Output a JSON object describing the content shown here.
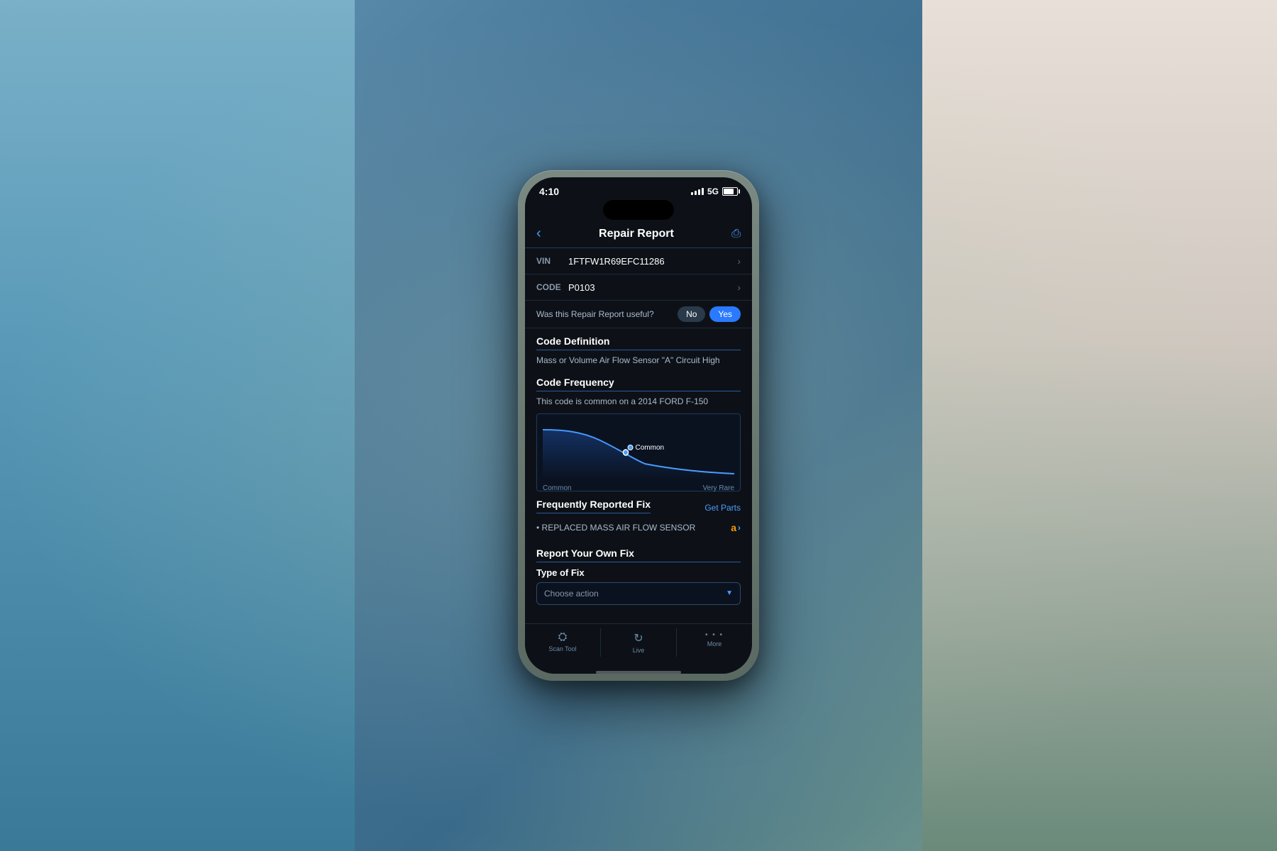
{
  "scene": {
    "background": "blurred car interior with blue frame visible"
  },
  "status_bar": {
    "time": "4:10",
    "signal_label": "5G",
    "battery_level": "80%"
  },
  "nav_header": {
    "back_icon": "chevron-left",
    "title": "Repair Report",
    "share_icon": "share"
  },
  "vin_field": {
    "label": "VIN",
    "value": "1FTFW1R69EFC11286",
    "chevron": "›"
  },
  "code_field": {
    "label": "CODE",
    "value": "P0103",
    "chevron": "›"
  },
  "useful_bar": {
    "question": "Was this Repair Report useful?",
    "no_label": "No",
    "yes_label": "Yes"
  },
  "code_definition": {
    "title": "Code Definition",
    "text": "Mass or Volume Air Flow Sensor \"A\" Circuit High"
  },
  "code_frequency": {
    "title": "Code Frequency",
    "description": "This code is common on a 2014 FORD F-150",
    "chart": {
      "point_label": "Common",
      "x_axis_left": "Common",
      "x_axis_right": "Very Rare"
    }
  },
  "frequently_reported_fix": {
    "title": "Frequently Reported Fix",
    "get_parts_label": "Get Parts",
    "fix_item": "• REPLACED MASS AIR FLOW SENSOR",
    "amazon_label": "a",
    "arrow_label": "›"
  },
  "report_own_fix": {
    "title": "Report Your Own Fix",
    "type_of_fix_label": "Type of Fix",
    "dropdown_placeholder": "Choose action",
    "dropdown_arrow": "▼"
  },
  "bottom_nav": {
    "items": [
      {
        "id": "scan-tool",
        "icon": "🔧",
        "label": "Scan Tool"
      },
      {
        "id": "live",
        "icon": "⟳",
        "label": "Live"
      },
      {
        "id": "more",
        "icon": "•••",
        "label": "More"
      }
    ]
  }
}
